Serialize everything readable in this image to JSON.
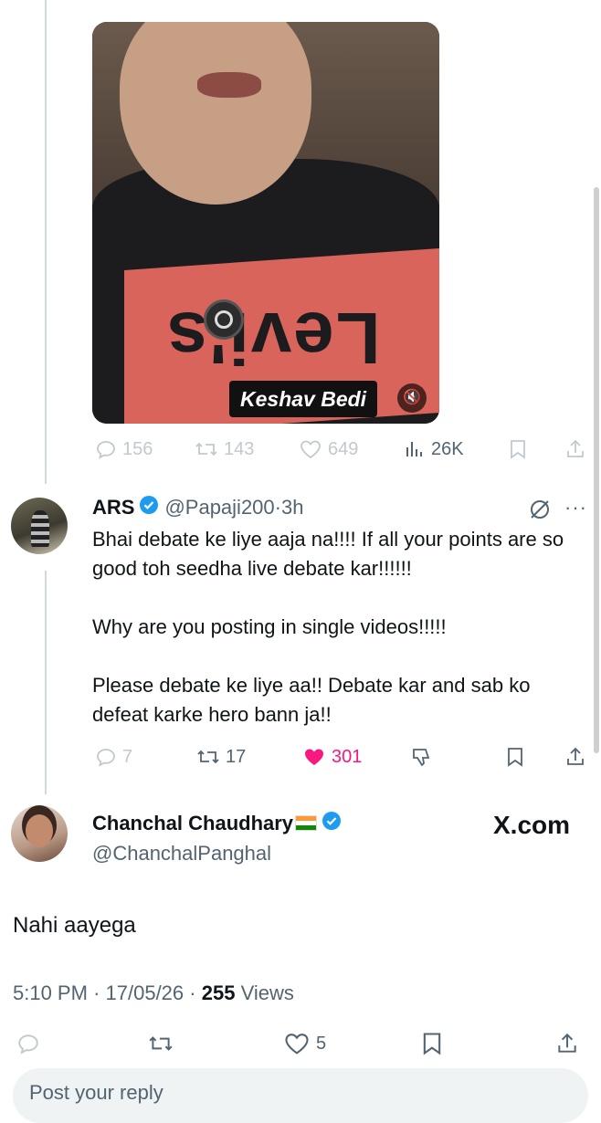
{
  "video": {
    "caption": "Keshav Bedi",
    "shirt_logo": "Levi's"
  },
  "video_actions": {
    "replies": "156",
    "reposts": "143",
    "likes": "649",
    "views": "26K"
  },
  "reply_tweet": {
    "display_name": "ARS",
    "handle": "@Papaji200",
    "time": "3h",
    "paragraphs": [
      "Bhai debate ke liye aaja na!!!! If all your points are so good toh seedha live debate kar!!!!!!",
      "Why are you posting in single videos!!!!!",
      "Please debate ke liye aa!! Debate kar and sab ko defeat karke hero bann ja!!"
    ],
    "actions": {
      "replies": "7",
      "reposts": "17",
      "likes": "301"
    }
  },
  "main_tweet": {
    "display_name": "Chanchal Chaudhary",
    "handle": "@ChanchalPanghal",
    "watermark": "X.com",
    "text": "Nahi aayega",
    "time": "5:10 PM",
    "date": "17/05/26",
    "views_count": "255",
    "views_label": "Views",
    "actions": {
      "likes": "5"
    }
  },
  "composer": {
    "placeholder": "Post your reply"
  },
  "colors": {
    "accent": "#1d9bf0",
    "like_active": "#f91880",
    "text": "#0f1419",
    "muted": "#536471"
  }
}
